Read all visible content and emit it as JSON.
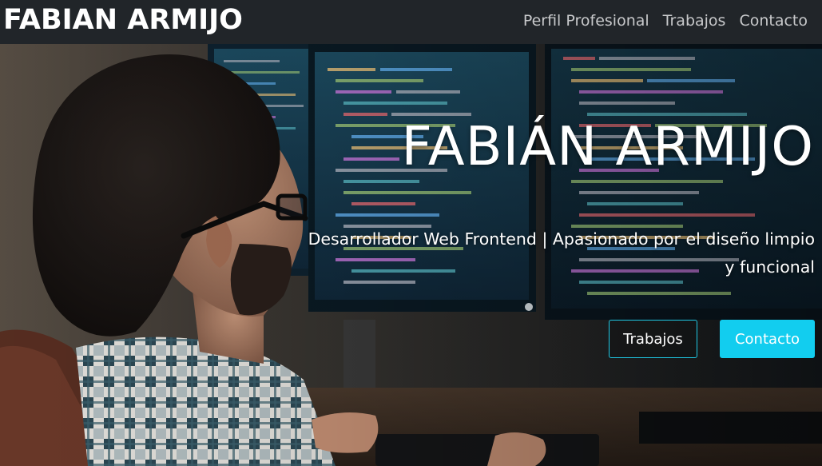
{
  "navbar": {
    "brand": "FABIAN ARMIJO",
    "links": [
      {
        "label": "Perfil Profesional"
      },
      {
        "label": "Trabajos"
      },
      {
        "label": "Contacto"
      }
    ]
  },
  "hero": {
    "title": "FABIÁN ARMIJO",
    "subtitle": "Desarrollador Web Frontend | Apasionado por el diseño limpio y funcional",
    "buttons": {
      "primary_outline": "Trabajos",
      "primary_solid": "Contacto"
    },
    "background_image": "developer-at-computer-photo"
  },
  "colors": {
    "navbar_bg": "#212529",
    "accent": "#12cdef",
    "text_light": "#ffffff",
    "nav_text": "#c8c9cb"
  }
}
